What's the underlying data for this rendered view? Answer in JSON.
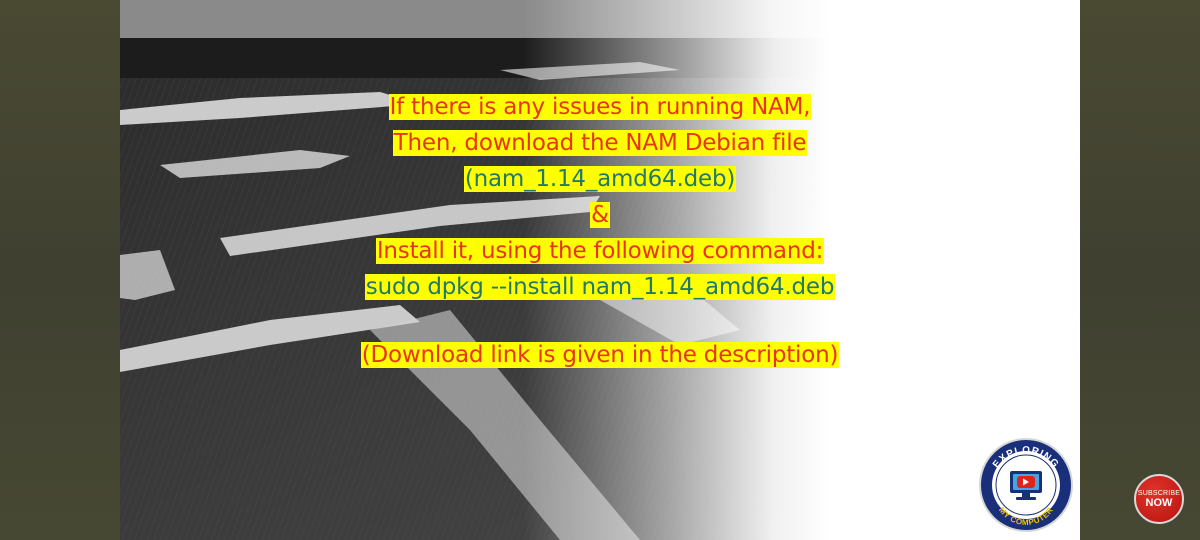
{
  "slide": {
    "lines": [
      {
        "text": "If there is any issues in running NAM,",
        "color": "#e8341c"
      },
      {
        "text": "Then, download the NAM Debian file",
        "color": "#e8341c"
      },
      {
        "text": "(nam_1.14_amd64.deb)",
        "color": "#1f7a6a"
      },
      {
        "text": "&",
        "color": "#e8341c"
      },
      {
        "text": "Install it, using the following command:",
        "color": "#e8341c"
      },
      {
        "text": "sudo dpkg --install  nam_1.14_amd64.deb",
        "color": "#1f7a6a"
      },
      {
        "text": "(Download link is given in the description)",
        "color": "#e8341c"
      }
    ],
    "highlight_color": "#ffff00"
  },
  "logo": {
    "top_text": "EXPLORING",
    "bottom_text": "MY COMPUTER",
    "icon": "play-monitor-icon"
  },
  "subscribe": {
    "line1": "SUBSCRIBE",
    "line2": "NOW",
    "color": "#c41d16"
  }
}
